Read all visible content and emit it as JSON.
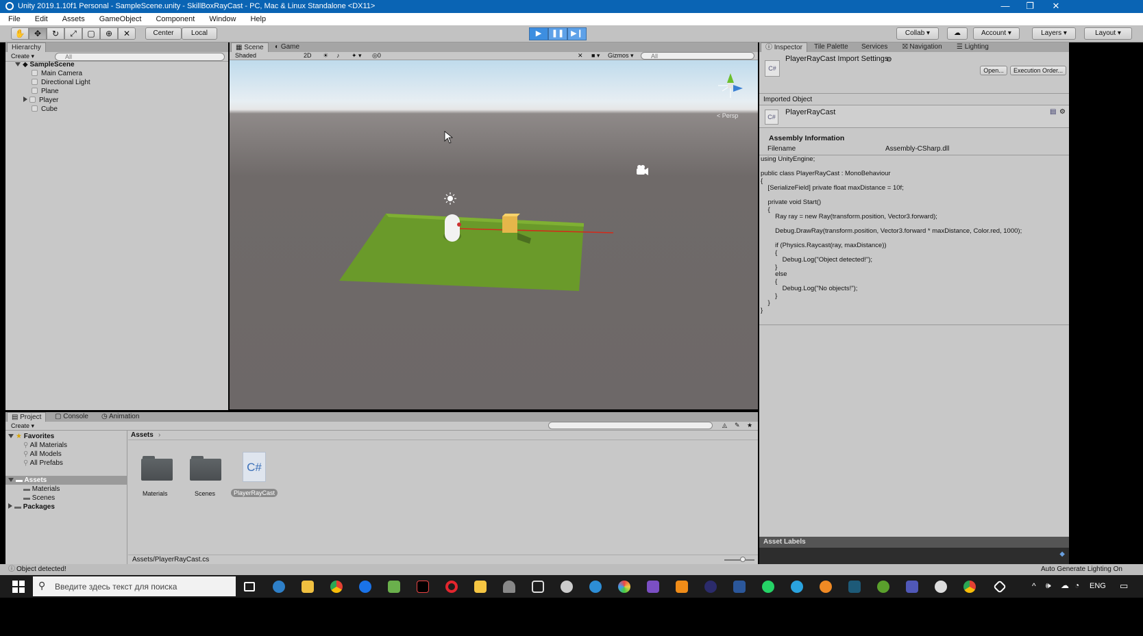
{
  "title_bar": {
    "title": "Unity 2019.1.10f1 Personal - SampleScene.unity - SkillBoxRayCast - PC, Mac & Linux Standalone <DX11>",
    "minimize": "—",
    "restore": "❐",
    "close": "✕"
  },
  "menu": [
    "File",
    "Edit",
    "Assets",
    "GameObject",
    "Component",
    "Window",
    "Help"
  ],
  "toolbar": {
    "pivot": "Center",
    "space": "Local",
    "collab": "Collab",
    "account": "Account",
    "layers": "Layers",
    "layout": "Layout"
  },
  "hierarchy": {
    "tab": "Hierarchy",
    "create": "Create",
    "search_placeholder": "All",
    "scene": "SampleScene",
    "items": [
      "Main Camera",
      "Directional Light",
      "Plane",
      "Player",
      "Cube"
    ]
  },
  "scene_tabs": [
    "Scene",
    "Game"
  ],
  "scene_toolbar": {
    "shading": "Shaded",
    "mode2d": "2D",
    "fx_count": "0",
    "gizmos": "Gizmos",
    "search_placeholder": "All",
    "persp": "< Persp"
  },
  "inspector": {
    "tabs": [
      "Inspector",
      "Tile Palette",
      "Services",
      "Navigation",
      "Lighting"
    ],
    "header_title": "PlayerRayCast Import Settings",
    "open_button": "Open...",
    "exec_order_button": "Execution Order...",
    "imported_object_label": "Imported Object",
    "object_name": "PlayerRayCast",
    "assembly_heading": "Assembly Information",
    "filename_label": "Filename",
    "filename_value": "Assembly-CSharp.dll",
    "code": "using UnityEngine;\n\npublic class PlayerRayCast : MonoBehaviour\n{\n    [SerializeField] private float maxDistance = 10f;\n\n    private void Start()\n    {\n        Ray ray = new Ray(transform.position, Vector3.forward);\n\n        Debug.DrawRay(transform.position, Vector3.forward * maxDistance, Color.red, 1000);\n\n        if (Physics.Raycast(ray, maxDistance))\n        {\n            Debug.Log(\"Object detected!\");\n        }\n        else\n        {\n            Debug.Log(\"No objects!\");\n        }\n    }\n}",
    "asset_labels": "Asset Labels",
    "cs_badge": "C#"
  },
  "project": {
    "tabs": [
      "Project",
      "Console",
      "Animation"
    ],
    "create": "Create",
    "favorites": "Favorites",
    "favorite_items": [
      "All Materials",
      "All Models",
      "All Prefabs"
    ],
    "assets_root": "Assets",
    "asset_children": [
      "Materials",
      "Scenes"
    ],
    "packages": "Packages",
    "breadcrumb": "Assets",
    "tiles": [
      "Materials",
      "Scenes",
      "PlayerRayCast"
    ],
    "cs_glyph": "C#",
    "path": "Assets/PlayerRayCast.cs"
  },
  "status": {
    "message": "Object detected!",
    "lighting": "Auto Generate Lighting On"
  },
  "taskbar": {
    "search_placeholder": "Введите здесь текст для поиска",
    "lang": "ENG"
  }
}
